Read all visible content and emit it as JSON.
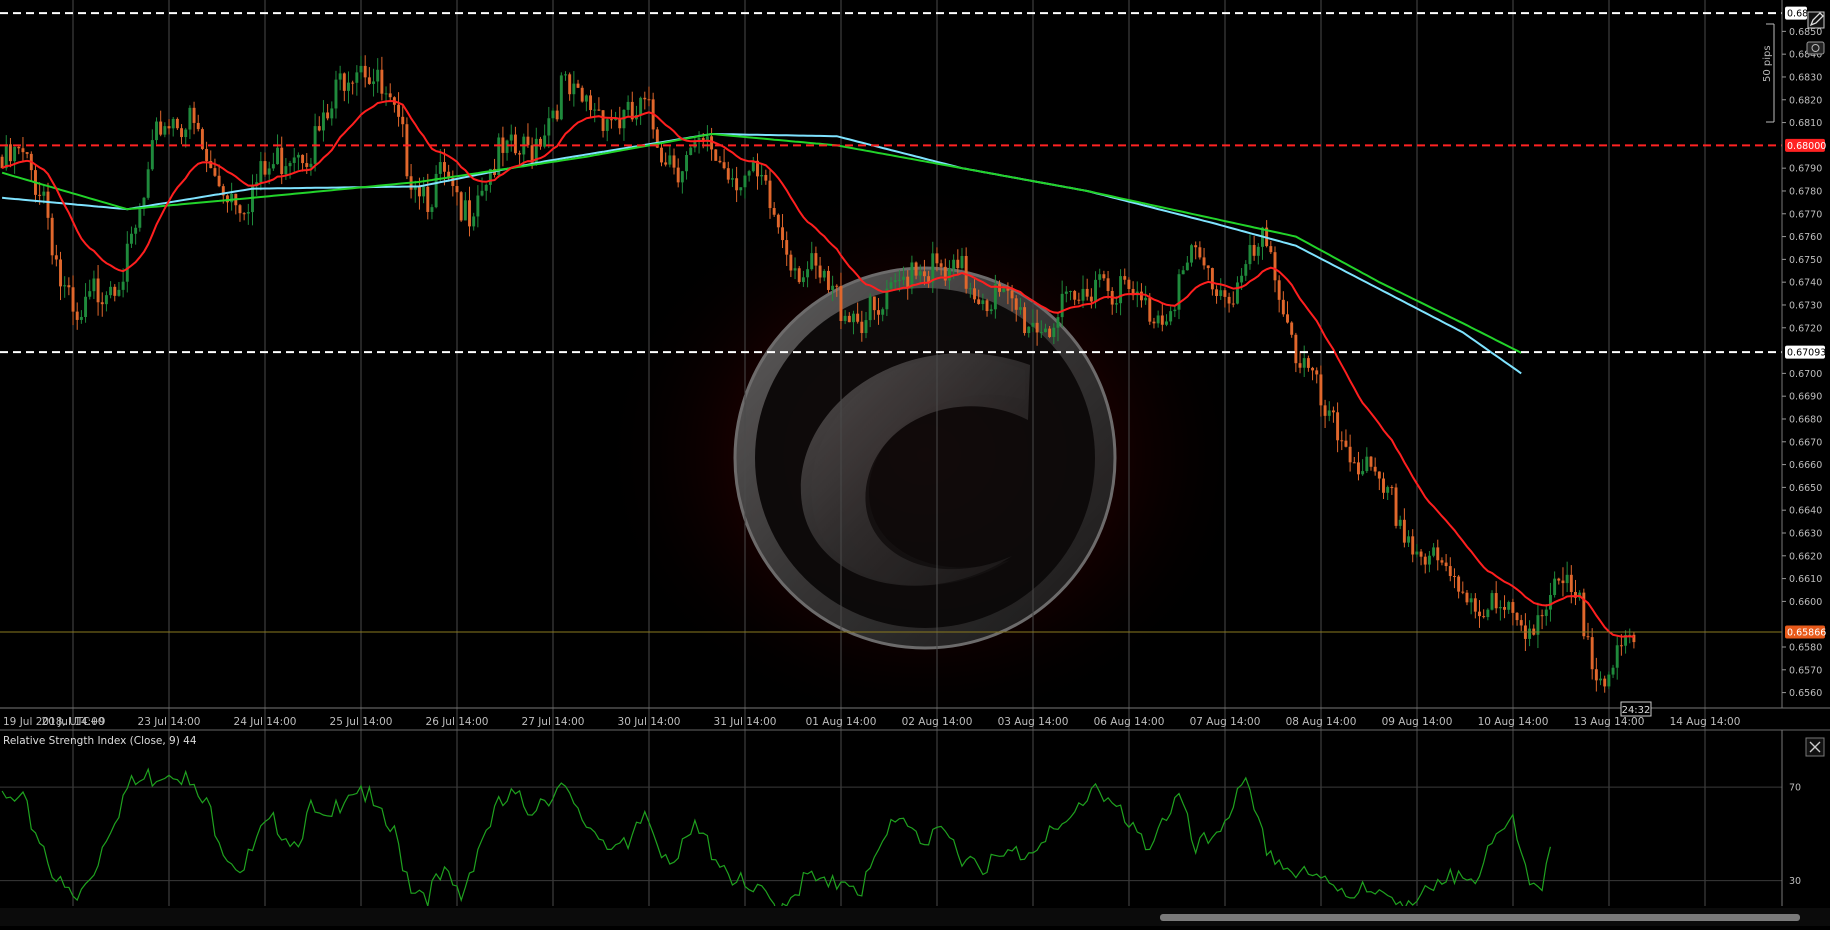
{
  "colors": {
    "background": "#000000",
    "grid": "#4a4a4a",
    "up_candle": "#1f8a3c",
    "down_candle": "#e0672c",
    "ema_fast": "#ff1f1f",
    "ma_green": "#22d32a",
    "ma_cyan": "#7fe3ff",
    "resistance_red": "#ff2222",
    "support_white": "#ffffff",
    "current_price": "#e85a1a",
    "rsi_line": "#1fa21f",
    "axis_text": "#bdbdbd"
  },
  "chart_data": [
    {
      "type": "candlestick",
      "symbol_timeframe": "",
      "x_axis_labels": [
        "19 Jul 2018, UTC+9",
        "20 Jul 14:00",
        "23 Jul 14:00",
        "24 Jul 14:00",
        "25 Jul 14:00",
        "26 Jul 14:00",
        "27 Jul 14:00",
        "30 Jul 14:00",
        "31 Jul 14:00",
        "01 Aug 14:00",
        "02 Aug 14:00",
        "03 Aug 14:00",
        "06 Aug 14:00",
        "07 Aug 14:00",
        "08 Aug 14:00",
        "09 Aug 14:00",
        "10 Aug 14:00",
        "13 Aug 14:00",
        "14 Aug 14:00"
      ],
      "y_ticks": [
        "0.6850",
        "0.6840",
        "0.6830",
        "0.6820",
        "0.6810",
        "0.6790",
        "0.6780",
        "0.6770",
        "0.6760",
        "0.6750",
        "0.6740",
        "0.6730",
        "0.6720",
        "0.6700",
        "0.6690",
        "0.6680",
        "0.6670",
        "0.6660",
        "0.6650",
        "0.6640",
        "0.6630",
        "0.6620",
        "0.6610",
        "0.6600",
        "0.6580",
        "0.6570",
        "0.6560"
      ],
      "ylim": [
        0.6555,
        0.6862
      ],
      "horizontal_lines": [
        {
          "label": "0.68",
          "value": 0.6858,
          "style": "dashed",
          "color": "white"
        },
        {
          "label": "0.68000",
          "value": 0.68,
          "style": "dashed",
          "color": "red"
        },
        {
          "label": "0.67093",
          "value": 0.67093,
          "style": "dashed",
          "color": "white"
        },
        {
          "label": "0.65866",
          "value": 0.65866,
          "style": "solid",
          "color": "current"
        }
      ],
      "countdown_label": "24:32",
      "pips_ruler_label": "50 pips",
      "close_path_anchors": [
        [
          0,
          0.6795
        ],
        [
          4,
          0.68
        ],
        [
          10,
          0.6785
        ],
        [
          14,
          0.6745
        ],
        [
          18,
          0.6722
        ],
        [
          22,
          0.674
        ],
        [
          26,
          0.6748
        ],
        [
          30,
          0.6752
        ],
        [
          34,
          0.678
        ],
        [
          38,
          0.6815
        ],
        [
          42,
          0.6818
        ],
        [
          46,
          0.6812
        ],
        [
          50,
          0.6792
        ],
        [
          54,
          0.6786
        ],
        [
          58,
          0.6782
        ],
        [
          62,
          0.679
        ],
        [
          66,
          0.6798
        ],
        [
          70,
          0.6806
        ],
        [
          74,
          0.6805
        ],
        [
          78,
          0.6815
        ],
        [
          82,
          0.6838
        ],
        [
          86,
          0.6845
        ],
        [
          90,
          0.683
        ],
        [
          94,
          0.6815
        ],
        [
          98,
          0.6795
        ],
        [
          102,
          0.6785
        ],
        [
          106,
          0.679
        ],
        [
          110,
          0.677
        ],
        [
          114,
          0.6788
        ],
        [
          118,
          0.6798
        ],
        [
          122,
          0.68
        ],
        [
          126,
          0.6802
        ],
        [
          130,
          0.6815
        ],
        [
          134,
          0.683
        ],
        [
          138,
          0.6822
        ],
        [
          142,
          0.6823
        ],
        [
          146,
          0.6818
        ],
        [
          150,
          0.6815
        ],
        [
          154,
          0.682
        ],
        [
          158,
          0.6805
        ],
        [
          162,
          0.6798
        ],
        [
          166,
          0.68
        ],
        [
          170,
          0.6803
        ],
        [
          174,
          0.6795
        ],
        [
          178,
          0.6792
        ],
        [
          182,
          0.6785
        ],
        [
          186,
          0.677
        ],
        [
          190,
          0.6755
        ],
        [
          194,
          0.6748
        ],
        [
          198,
          0.674
        ],
        [
          202,
          0.6735
        ],
        [
          206,
          0.673
        ],
        [
          210,
          0.6728
        ],
        [
          214,
          0.674
        ],
        [
          218,
          0.6755
        ],
        [
          222,
          0.6752
        ],
        [
          226,
          0.6745
        ],
        [
          230,
          0.6748
        ],
        [
          234,
          0.6742
        ],
        [
          238,
          0.6738
        ],
        [
          242,
          0.6733
        ],
        [
          246,
          0.6728
        ],
        [
          250,
          0.6727
        ],
        [
          254,
          0.673
        ],
        [
          258,
          0.6735
        ],
        [
          262,
          0.675
        ],
        [
          266,
          0.6745
        ],
        [
          270,
          0.6738
        ],
        [
          274,
          0.6733
        ],
        [
          278,
          0.6732
        ],
        [
          282,
          0.6745
        ],
        [
          286,
          0.6755
        ],
        [
          290,
          0.6745
        ],
        [
          294,
          0.674
        ],
        [
          298,
          0.675
        ],
        [
          302,
          0.676
        ],
        [
          306,
          0.6745
        ],
        [
          310,
          0.6715
        ],
        [
          314,
          0.67
        ],
        [
          318,
          0.668
        ],
        [
          322,
          0.6675
        ],
        [
          326,
          0.6665
        ],
        [
          330,
          0.665
        ],
        [
          334,
          0.6645
        ],
        [
          338,
          0.663
        ],
        [
          342,
          0.6622
        ],
        [
          346,
          0.6615
        ],
        [
          350,
          0.6612
        ],
        [
          354,
          0.6605
        ],
        [
          358,
          0.66
        ],
        [
          362,
          0.6595
        ],
        [
          366,
          0.6598
        ],
        [
          370,
          0.6602
        ],
        [
          374,
          0.661
        ],
        [
          378,
          0.66
        ],
        [
          382,
          0.658
        ],
        [
          386,
          0.6573
        ],
        [
          390,
          0.6585
        ]
      ],
      "ma_green_anchors": [
        [
          0,
          0.6788
        ],
        [
          30,
          0.6772
        ],
        [
          60,
          0.6777
        ],
        [
          100,
          0.6784
        ],
        [
          140,
          0.6795
        ],
        [
          170,
          0.6805
        ],
        [
          200,
          0.68
        ],
        [
          230,
          0.679
        ],
        [
          260,
          0.678
        ],
        [
          290,
          0.6768
        ],
        [
          310,
          0.676
        ],
        [
          330,
          0.674
        ],
        [
          350,
          0.6722
        ],
        [
          364,
          0.6709
        ]
      ],
      "ma_cyan_anchors": [
        [
          0,
          0.6777
        ],
        [
          30,
          0.6772
        ],
        [
          60,
          0.6781
        ],
        [
          100,
          0.6782
        ],
        [
          130,
          0.6793
        ],
        [
          170,
          0.6805
        ],
        [
          200,
          0.6804
        ],
        [
          230,
          0.679
        ],
        [
          260,
          0.678
        ],
        [
          290,
          0.6766
        ],
        [
          310,
          0.6756
        ],
        [
          330,
          0.6737
        ],
        [
          350,
          0.6718
        ],
        [
          364,
          0.67
        ]
      ]
    },
    {
      "type": "line",
      "title": "Relative Strength Index (Close, 9) 44",
      "ylim": [
        20,
        85
      ],
      "y_ticks": [
        "70",
        "30"
      ],
      "levels": [
        70,
        30
      ],
      "rsi_anchors": [
        [
          0,
          67
        ],
        [
          5,
          65
        ],
        [
          10,
          48
        ],
        [
          14,
          30
        ],
        [
          18,
          24
        ],
        [
          22,
          38
        ],
        [
          26,
          58
        ],
        [
          30,
          72
        ],
        [
          34,
          76
        ],
        [
          38,
          80
        ],
        [
          42,
          82
        ],
        [
          46,
          70
        ],
        [
          50,
          62
        ],
        [
          54,
          45
        ],
        [
          58,
          38
        ],
        [
          62,
          52
        ],
        [
          66,
          58
        ],
        [
          70,
          50
        ],
        [
          74,
          62
        ],
        [
          78,
          55
        ],
        [
          82,
          72
        ],
        [
          86,
          74
        ],
        [
          90,
          60
        ],
        [
          94,
          52
        ],
        [
          98,
          32
        ],
        [
          102,
          28
        ],
        [
          106,
          34
        ],
        [
          110,
          26
        ],
        [
          114,
          48
        ],
        [
          118,
          62
        ],
        [
          122,
          68
        ],
        [
          126,
          64
        ],
        [
          130,
          70
        ],
        [
          134,
          72
        ],
        [
          138,
          60
        ],
        [
          142,
          55
        ],
        [
          146,
          50
        ],
        [
          150,
          44
        ],
        [
          154,
          62
        ],
        [
          158,
          48
        ],
        [
          162,
          42
        ],
        [
          166,
          54
        ],
        [
          170,
          47
        ],
        [
          174,
          38
        ],
        [
          178,
          28
        ],
        [
          182,
          26
        ],
        [
          186,
          22
        ],
        [
          190,
          30
        ],
        [
          194,
          34
        ],
        [
          198,
          28
        ],
        [
          202,
          36
        ],
        [
          206,
          30
        ],
        [
          210,
          42
        ],
        [
          214,
          62
        ],
        [
          218,
          58
        ],
        [
          222,
          48
        ],
        [
          226,
          52
        ],
        [
          230,
          45
        ],
        [
          234,
          42
        ],
        [
          238,
          40
        ],
        [
          242,
          44
        ],
        [
          246,
          46
        ],
        [
          250,
          55
        ],
        [
          254,
          52
        ],
        [
          258,
          64
        ],
        [
          262,
          76
        ],
        [
          266,
          66
        ],
        [
          270,
          54
        ],
        [
          274,
          48
        ],
        [
          278,
          60
        ],
        [
          282,
          68
        ],
        [
          286,
          44
        ],
        [
          290,
          52
        ],
        [
          294,
          64
        ],
        [
          298,
          72
        ],
        [
          302,
          50
        ],
        [
          306,
          42
        ],
        [
          310,
          36
        ],
        [
          314,
          32
        ],
        [
          318,
          34
        ],
        [
          322,
          30
        ],
        [
          326,
          28
        ],
        [
          330,
          24
        ],
        [
          334,
          28
        ],
        [
          338,
          24
        ],
        [
          342,
          26
        ],
        [
          346,
          30
        ],
        [
          350,
          40
        ],
        [
          354,
          36
        ],
        [
          358,
          48
        ],
        [
          362,
          60
        ],
        [
          364,
          50
        ],
        [
          366,
          34
        ],
        [
          368,
          32
        ],
        [
          370,
          36
        ],
        [
          371,
          44
        ]
      ]
    }
  ]
}
